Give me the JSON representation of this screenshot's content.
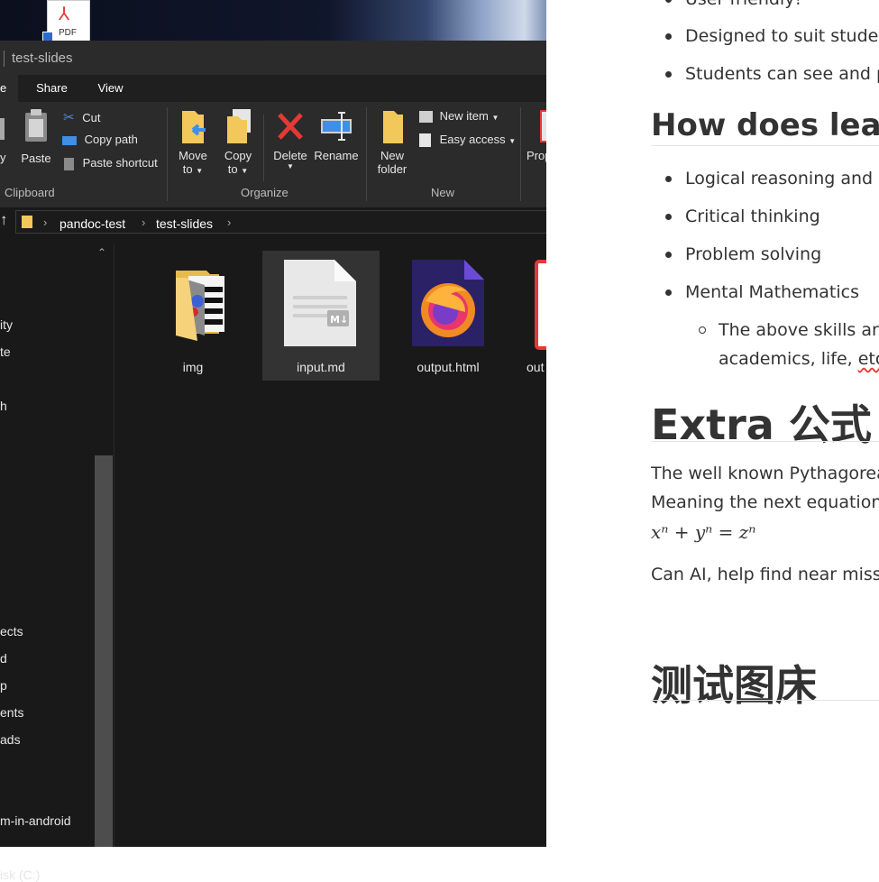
{
  "explorer": {
    "title": "test-slides",
    "tabs": {
      "file": "e",
      "share": "Share",
      "view": "View"
    },
    "ribbon": {
      "clipboard": {
        "paste": "Paste",
        "cut": "Cut",
        "copy_path": "Copy path",
        "paste_shortcut": "Paste shortcut",
        "label": "Clipboard",
        "partial": "y"
      },
      "organize": {
        "move_to_1": "Move",
        "move_to_2": "to",
        "copy_to_1": "Copy",
        "copy_to_2": "to",
        "delete": "Delete",
        "rename": "Rename",
        "label": "Organize"
      },
      "new": {
        "new_folder_1": "New",
        "new_folder_2": "folder",
        "new_item": "New item",
        "easy_access": "Easy access",
        "label": "New"
      },
      "open": {
        "properties": "Prop"
      }
    },
    "address": {
      "crumbs": [
        "pandoc-test",
        "test-slides"
      ]
    },
    "nav_items": [
      "ity",
      "te",
      "h",
      "ects",
      "d",
      "p",
      "ents",
      "ads",
      "m-in-android",
      "isk (C:)"
    ],
    "files": [
      {
        "name": "img",
        "icon": "folder-icon"
      },
      {
        "name": "input.md",
        "icon": "markdown-file-icon"
      },
      {
        "name": "output.html",
        "icon": "firefox-icon"
      },
      {
        "name": "out",
        "icon": "pdf-file-icon"
      }
    ],
    "desktop_pdf_label": "PDF"
  },
  "document": {
    "list1": [
      "User friendly!",
      "Designed to suit studer",
      "Students can see and p"
    ],
    "heading1": "How does learr",
    "list2": [
      "Logical reasoning and S",
      "Critical thinking",
      "Problem solving",
      "Mental Mathematics"
    ],
    "sublist_line1": "The above skills are",
    "sublist_line2a": "academics, life, ",
    "sublist_line2b": "etc.",
    "heading2": "Extra 公式",
    "para1": "The well known Pythagorea",
    "para2": "Meaning the next equation",
    "math": "xⁿ + yⁿ = zⁿ",
    "para3": "Can AI, help find near misse",
    "heading3": "测试图床"
  },
  "colors": {
    "explorer_bg": "#191919",
    "ribbon_bg": "#2b2b2b",
    "accent_red": "#e53935",
    "text_dark": "#333333"
  }
}
